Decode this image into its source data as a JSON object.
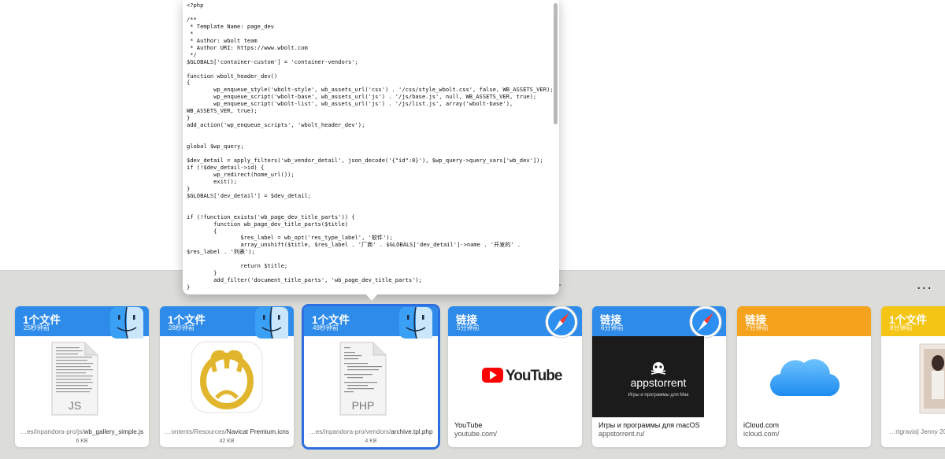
{
  "preview": {
    "code": "<?php\n\n/**\n * Template Name: page_dev\n *\n * Author: wbolt team\n * Author URI: https://www.wbolt.com\n */\n$GLOBALS['container-custom'] = 'container-vendors';\n\nfunction wbolt_header_dev()\n{\n        wp_enqueue_style('wbolt-style', wb_assets_url('css') . '/css/style_wbolt.css', false, WB_ASSETS_VER);\n        wp_enqueue_script('wbolt-base', wb_assets_url('js') . '/js/base.js', null, WB_ASSETS_VER, true);\n        wp_enqueue_script('wbolt-list', wb_assets_url('js') . '/js/list.js', array('wbolt-base'),\nWB_ASSETS_VER, true);\n}\nadd_action('wp_enqueue_scripts', 'wbolt_header_dev');\n\n\nglobal $wp_query;\n\n$dev_detail = apply_filters('wb_vendor_detail', json_decode('{\"id\":0}'), $wp_query->query_vars['wb_dev']);\nif (!$dev_detail->id) {\n        wp_redirect(home_url());\n        exit();\n}\n$GLOBALS['dev_detail'] = $dev_detail;\n\n\nif (!function_exists('wb_page_dev_title_parts')) {\n        function wb_page_dev_title_parts($title)\n        {\n                $res_label = wb_opt('res_type_label', '软件');\n                array_unshift($title, $res_label . '厂商' . $GLOBALS['dev_detail']->name . '开发的' .\n$res_label . '列表');\n\n                return $title;\n        }\n        add_filter('document_title_parts', 'wb_page_dev_title_parts');\n}\n\nif (!function_exists('wb_page_dev_wp_head')) {\n        function wb_page_dev_wp_head()\n        {"
  },
  "shelf": {
    "more_label": "···",
    "mark": "+",
    "cards": [
      {
        "kind": "file",
        "title": "1个文件",
        "time": "25秒钟前",
        "path_dim": "…es/inpandora-pro/js/",
        "path_name": "wb_gallery_simple.js",
        "size": "6 KB",
        "doc_label": "JS"
      },
      {
        "kind": "file",
        "title": "1个文件",
        "time": "28秒钟前",
        "path_dim": "…ontents/Resources/",
        "path_name": "Navicat Premium.icns",
        "size": "42 KB"
      },
      {
        "kind": "file",
        "title": "1个文件",
        "time": "49秒钟前",
        "path_dim": "…es/inpandora-pro/vendors/",
        "path_name": "archive.tpl.php",
        "size": "4 KB",
        "doc_label": "PHP"
      },
      {
        "kind": "link",
        "title": "链接",
        "time": "5分钟前",
        "link_title": "YouTube",
        "url": "youtube.com/",
        "brand": "YouTube"
      },
      {
        "kind": "link",
        "title": "链接",
        "time": "6分钟前",
        "link_title": "Игры и программы для macOS",
        "url": "appstorrent.ru/",
        "brand": "appstorrent",
        "brand_sub": "Игры и программы для Мак"
      },
      {
        "kind": "link",
        "title": "链接",
        "time": "7分钟前",
        "link_title": "iCloud.com",
        "url": "icloud.com/"
      },
      {
        "kind": "file",
        "title": "1个文件",
        "time": "8分钟前",
        "path_dim": "…rtgravia] Jenny 20",
        "path_name": ""
      }
    ]
  },
  "colors": {
    "file_header": "#2f8be9",
    "icloud_header": "#f5a21d",
    "photo_header": "#f5c515",
    "selection": "#2d6fe0",
    "youtube_red": "#ff0000"
  },
  "icons": [
    "finder-icon",
    "safari-icon",
    "navicat-icon",
    "icloud-icon",
    "youtube-logo",
    "appstorrent-logo"
  ]
}
